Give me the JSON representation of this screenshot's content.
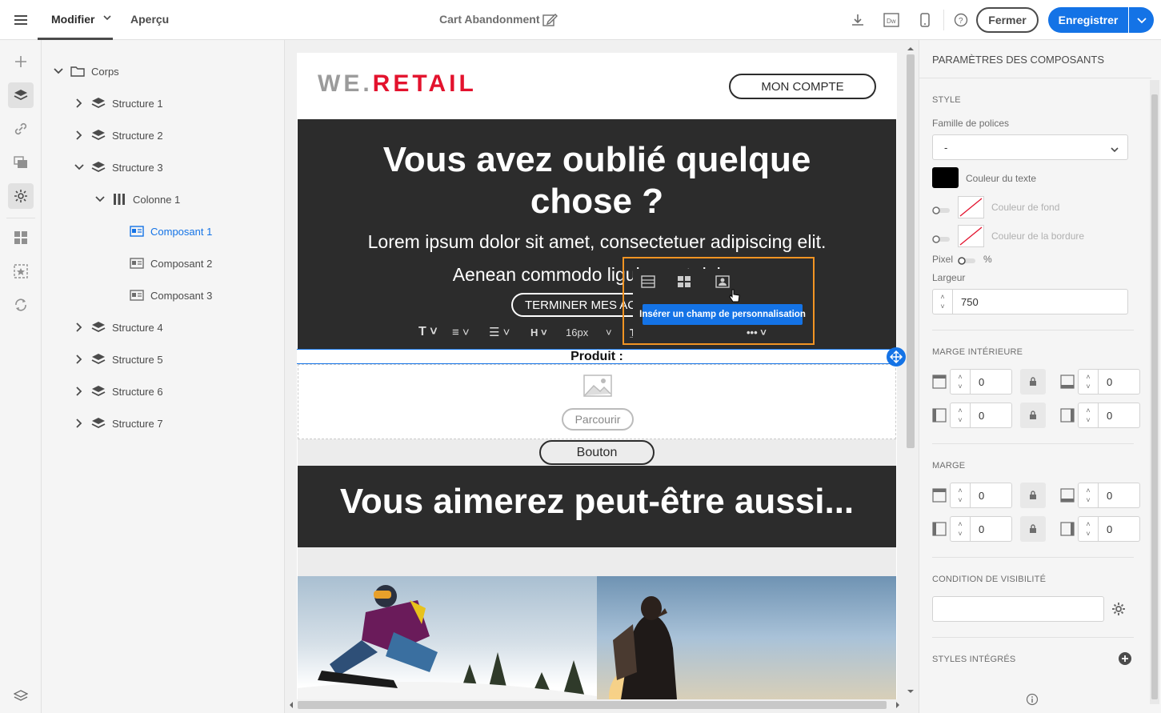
{
  "topbar": {
    "tab_edit": "Modifier",
    "tab_preview": "Aperçu",
    "doc_title": "Cart Abandonment",
    "btn_close": "Fermer",
    "btn_save": "Enregistrer"
  },
  "tree": {
    "root": "Corps",
    "structures": [
      "Structure 1",
      "Structure 2",
      "Structure 3",
      "Structure 4",
      "Structure 5",
      "Structure 6",
      "Structure 7"
    ],
    "column": "Colonne 1",
    "components": [
      "Composant 1",
      "Composant 2",
      "Composant 3"
    ]
  },
  "email": {
    "logo_we": "WE",
    "logo_dot": ".",
    "logo_retail": "RETAIL",
    "account_btn": "MON COMPTE",
    "hero_title_l1": "Vous avez oublié quelque",
    "hero_title_l2": "chose ?",
    "hero_text_l1": "Lorem ipsum dolor sit amet, consectetuer adipiscing elit.",
    "hero_text_l2": "Aenean commodo ligula eget dolor.",
    "cta": "TERMINER MES ACHATS",
    "product_label": "Produit :",
    "browse": "Parcourir",
    "button": "Bouton",
    "section2_title": "Vous aimerez peut-être aussi...",
    "toolbar_font_size": "16px",
    "tooltip": "Insérer un champ de personnalisation"
  },
  "panel": {
    "title": "PARAMÈTRES DES COMPOSANTS",
    "style": "STYLE",
    "font_family_label": "Famille de polices",
    "font_family_value": "-",
    "text_color": "Couleur du texte",
    "bg_color": "Couleur de fond",
    "border_color": "Couleur de la bordure",
    "pixel": "Pixel",
    "percent": "%",
    "width_label": "Largeur",
    "width_value": "750",
    "padding": "MARGE INTÉRIEURE",
    "margin": "MARGE",
    "padding_values": [
      "0",
      "0",
      "0",
      "0"
    ],
    "margin_values": [
      "0",
      "0",
      "0",
      "0"
    ],
    "visibility": "CONDITION DE VISIBILITÉ",
    "styles": "STYLES INTÉGRÉS"
  },
  "colors": {
    "accent": "#1473e6",
    "hero_bg": "#2c2c2c",
    "logo_red": "#e3122d",
    "highlight": "#f29423"
  }
}
